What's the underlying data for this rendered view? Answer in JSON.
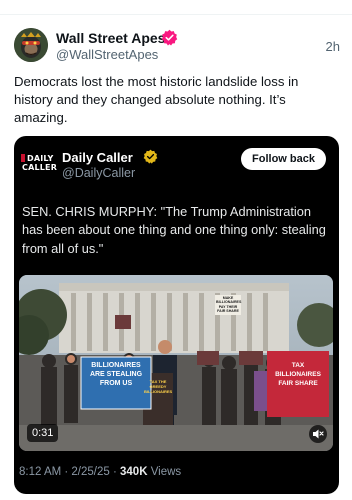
{
  "post": {
    "author_name": "Wall Street Apes",
    "author_handle": "@WallStreetApes",
    "time": "2h",
    "text": "Democrats lost the most historic landslide loss in history and they changed absolute nothing. It’s amazing.",
    "avatar_icon": "ape-avatar",
    "verified_color": "#f91880"
  },
  "quote": {
    "logo_line1": "DAILY",
    "logo_line2": "CALLER",
    "author_name": "Daily Caller",
    "author_handle": "@DailyCaller",
    "follow_label": "Follow back",
    "text": "SEN. CHRIS MURPHY: \"The Trump Administration has been about one thing and one thing only: stealing from all of us.\"",
    "video": {
      "duration": "0:31",
      "sign_left": "BILLIONAIRES ARE STEALING FROM US",
      "sign_right": "TAX BILLIONAIRES FAIR SHARE",
      "sign_podium": "TAX THE GREEDY BILLIONAIRES",
      "sign_top": "MAKE BILLIONAIRES PAY THEIR FAIR SHARE"
    },
    "timestamp": "8:12 AM · 2/25/25 · ",
    "views_count": "340K",
    "views_label": " Views",
    "verified_color": "#e2b719"
  }
}
